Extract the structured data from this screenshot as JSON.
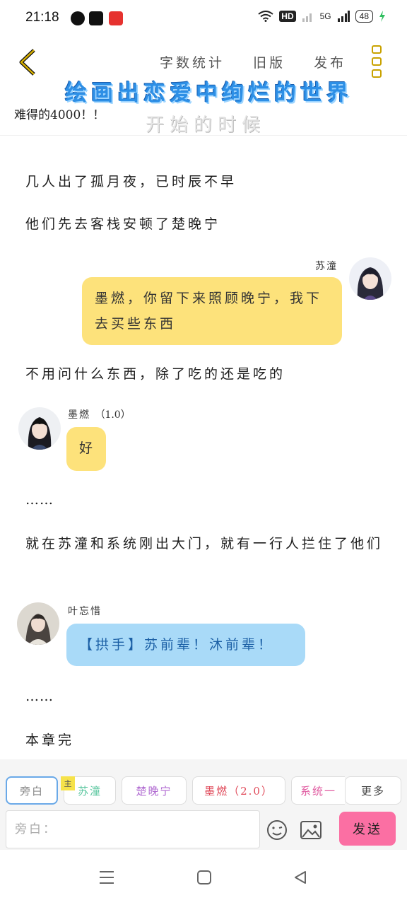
{
  "status": {
    "time": "21:18",
    "network": "HD",
    "signal": "5G",
    "battery": "48"
  },
  "header": {
    "meta": [
      "字数统计",
      "旧版",
      "发布"
    ],
    "banner_title": "绘画出恋爱中绚烂的世界",
    "banner_subtitle": "开始的时候",
    "note": "难得的4000！！"
  },
  "messages": [
    {
      "type": "narration",
      "text": "几人出了孤月夜，已时辰不早"
    },
    {
      "type": "narration",
      "text": "他们先去客栈安顿了楚晚宁"
    },
    {
      "type": "right",
      "speaker": "苏潼",
      "text": "墨燃，你留下来照顾晚宁，我下去买些东西"
    },
    {
      "type": "narration",
      "text": "不用问什么东西，除了吃的还是吃的"
    },
    {
      "type": "left",
      "speaker": "墨燃",
      "speaker_tag": "（1.0）",
      "text": "好"
    },
    {
      "type": "narration",
      "text": "……"
    },
    {
      "type": "narration",
      "text": "就在苏潼和系统刚出大门，就有一行人拦住了他们"
    },
    {
      "type": "left",
      "speaker": "叶忘惜",
      "text": "【拱手】苏前辈！沐前辈！"
    },
    {
      "type": "narration",
      "text": "……"
    },
    {
      "type": "narration",
      "text": "本章完"
    }
  ],
  "roles": {
    "main_tag": "主",
    "items": [
      {
        "label": "旁白",
        "color": "#888888"
      },
      {
        "label": "苏潼",
        "color": "#5cc7a0"
      },
      {
        "label": "楚晚宁",
        "color": "#b06ad1"
      },
      {
        "label": "墨燃（2.0）",
        "color": "#e04a5a"
      },
      {
        "label": "系统一",
        "color": "#e05aa0"
      },
      {
        "label": "更多",
        "color": "#444444"
      }
    ]
  },
  "input": {
    "placeholder": "旁白：",
    "send_label": "发送"
  },
  "colors": {
    "accent": "#fb6fa3",
    "bubble_yellow": "#fde27b",
    "bubble_blue": "#a9daf8",
    "icon_gold": "#c9a200"
  }
}
